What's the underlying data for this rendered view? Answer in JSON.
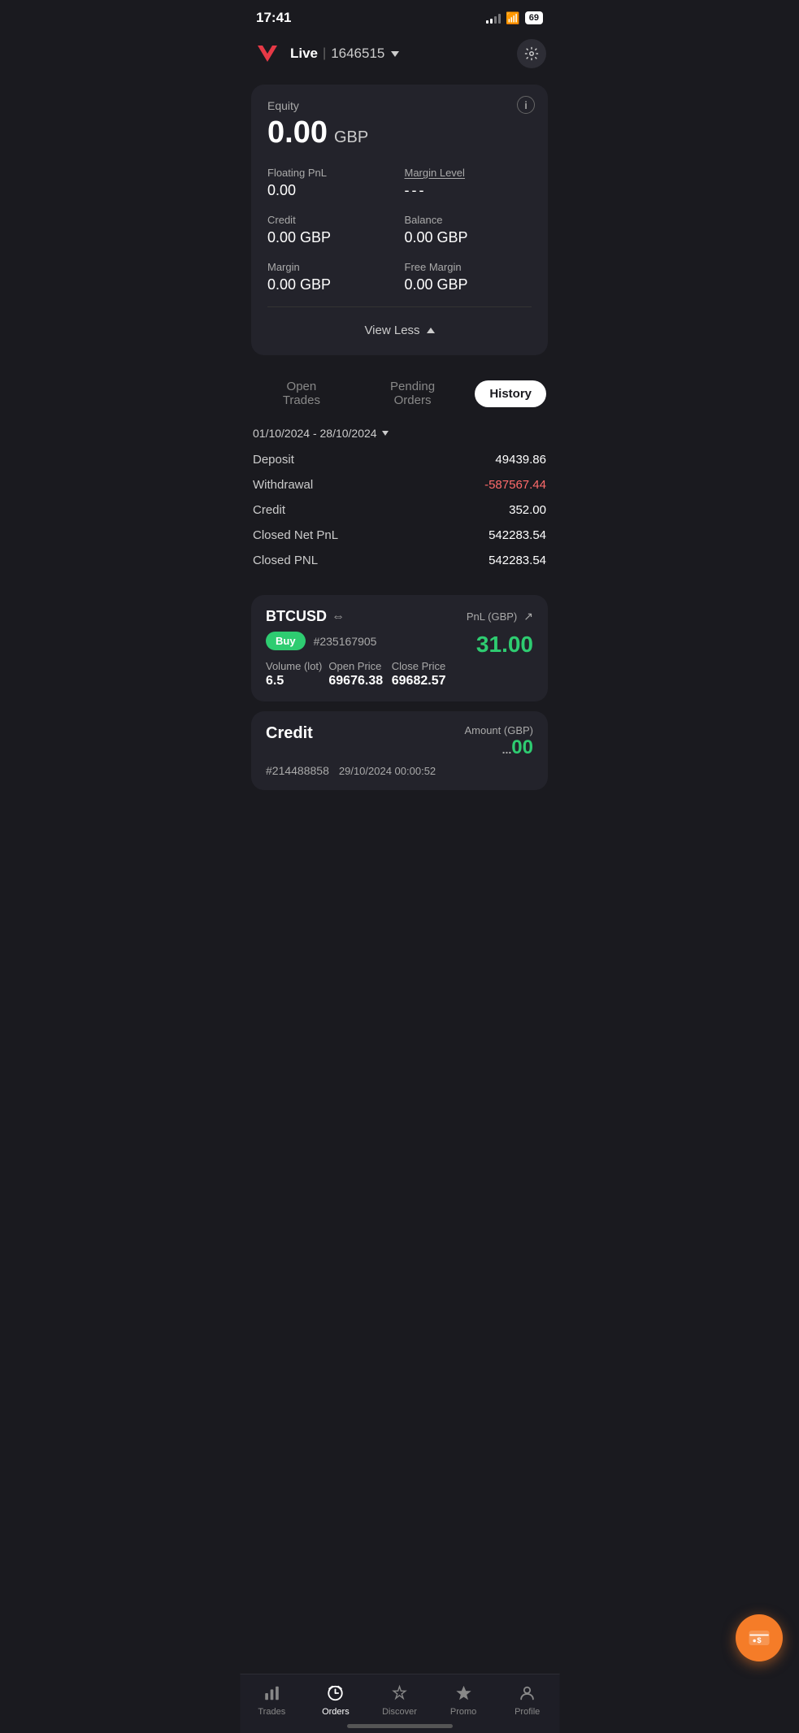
{
  "statusBar": {
    "time": "17:41",
    "battery": "69"
  },
  "header": {
    "live": "Live",
    "accountNumber": "1646515",
    "settingsIcon": "⚙"
  },
  "accountCard": {
    "equityLabel": "Equity",
    "equityValue": "0.00",
    "equityCurrency": "GBP",
    "infoIcon": "i",
    "floatingPnlLabel": "Floating PnL",
    "floatingPnlValue": "0.00",
    "marginLevelLabel": "Margin Level",
    "marginLevelValue": "---",
    "creditLabel": "Credit",
    "creditValue": "0.00 GBP",
    "balanceLabel": "Balance",
    "balanceValue": "0.00 GBP",
    "marginLabel": "Margin",
    "marginValue": "0.00 GBP",
    "freeMarginLabel": "Free Margin",
    "freeMarginValue": "0.00 GBP",
    "viewLessLabel": "View Less"
  },
  "tabs": {
    "openTrades": "Open Trades",
    "pendingOrders": "Pending Orders",
    "history": "History"
  },
  "historySection": {
    "dateRange": "01/10/2024 - 28/10/2024",
    "depositLabel": "Deposit",
    "depositValue": "49439.86",
    "withdrawalLabel": "Withdrawal",
    "withdrawalValue": "-587567.44",
    "creditLabel": "Credit",
    "creditValue": "352.00",
    "closedNetPnlLabel": "Closed Net PnL",
    "closedNetPnlValue": "542283.54",
    "closedPnlLabel": "Closed PNL",
    "closedPnlValue": "542283.54"
  },
  "tradeCard": {
    "symbol": "BTCUSD",
    "symbolIcon": "⇔",
    "pnlLabel": "PnL (GBP)",
    "pnlValue": "31.00",
    "direction": "Buy",
    "orderNumber": "#235167905",
    "volumeLabel": "Volume (lot)",
    "volumeValue": "6.5",
    "openPriceLabel": "Open Price",
    "openPriceValue": "69676.38",
    "closePriceLabel": "Close Price",
    "closePriceValue": "69682.57"
  },
  "creditEntry": {
    "title": "Credit",
    "amountLabel": "Amount (GBP)",
    "id": "#214488858",
    "date": "29/10/2024 00:00:52",
    "amount": "00"
  },
  "bottomNav": {
    "trades": "Trades",
    "orders": "Orders",
    "discover": "Discover",
    "promo": "Promo",
    "profile": "Profile"
  }
}
